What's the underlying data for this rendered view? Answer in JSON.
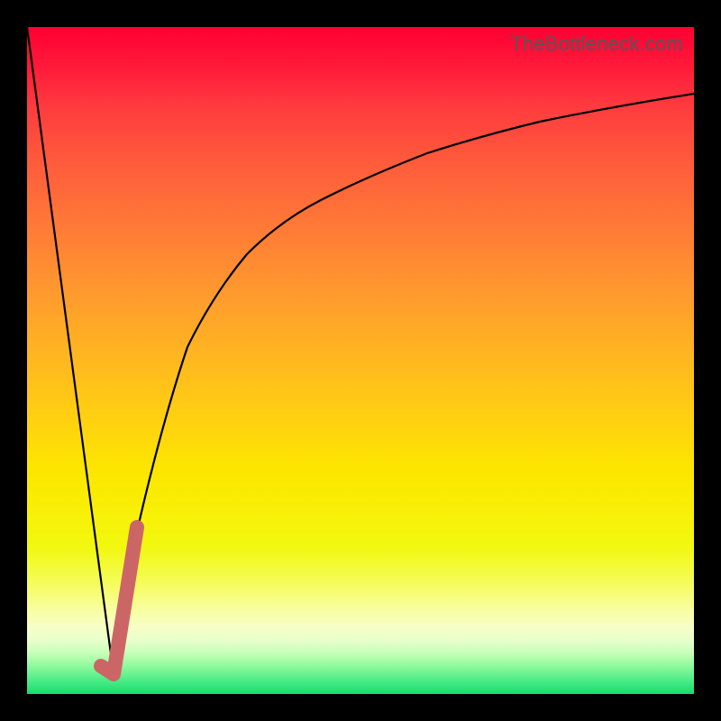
{
  "watermark": "TheBottleneck.com",
  "colors": {
    "frame": "#000000",
    "curve": "#000000",
    "marker": "#cc6666",
    "gradient_top": "#ff0033",
    "gradient_bottom": "#18dc6e"
  },
  "chart_data": {
    "type": "line",
    "title": "",
    "xlabel": "",
    "ylabel": "",
    "xlim": [
      0,
      100
    ],
    "ylim": [
      0,
      100
    ],
    "series": [
      {
        "name": "bottleneck-curve-left",
        "x": [
          0,
          13
        ],
        "values": [
          100,
          3
        ]
      },
      {
        "name": "bottleneck-curve-right",
        "x": [
          13,
          16,
          20,
          24,
          28,
          33,
          38,
          44,
          51,
          59,
          68,
          78,
          88,
          100
        ],
        "values": [
          3,
          22,
          40,
          52,
          60,
          66,
          71,
          75,
          79,
          82,
          85,
          87,
          89,
          90
        ]
      },
      {
        "name": "marker-hook",
        "x": [
          11,
          13,
          16.5
        ],
        "values": [
          4.2,
          3,
          25
        ]
      }
    ],
    "annotations": [
      {
        "text": "TheBottleneck.com",
        "pos": "top-right"
      }
    ]
  }
}
